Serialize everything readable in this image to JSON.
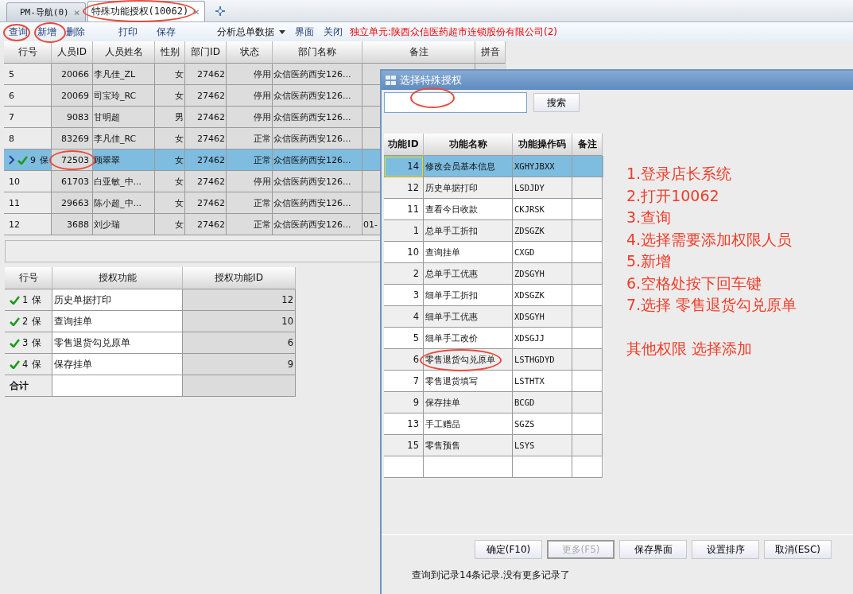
{
  "tabs": [
    {
      "label": "PM-导航(0)",
      "selected": false,
      "close": "×"
    },
    {
      "label": "特殊功能授权(10062)",
      "selected": true,
      "close": "×"
    }
  ],
  "toolbar": {
    "items": [
      {
        "label": "查询",
        "kind": "button"
      },
      {
        "label": "新增",
        "kind": "button"
      },
      {
        "label": "删除",
        "kind": "button"
      },
      {
        "label": "打印",
        "kind": "button"
      },
      {
        "label": "保存",
        "kind": "button"
      },
      {
        "label": "分析总单数据",
        "kind": "dropdown"
      },
      {
        "label": "界面",
        "kind": "button"
      },
      {
        "label": "关闭",
        "kind": "button"
      }
    ],
    "notice": "独立单元:陕西众信医药超市连锁股份有限公司(2)"
  },
  "main_grid": {
    "columns": [
      "行号",
      "人员ID",
      "人员姓名",
      "性别",
      "部门ID",
      "状态",
      "部门名称",
      "备注",
      "拼音"
    ],
    "rows": [
      {
        "no": "5",
        "id": "20066",
        "name": "李凡佳_ZL",
        "sex": "女",
        "dept_id": "27462",
        "status": "停用",
        "dept": "众信医药西安126...",
        "selected": false,
        "current": false,
        "saved": false
      },
      {
        "no": "6",
        "id": "20069",
        "name": "司宝玲_RC",
        "sex": "女",
        "dept_id": "27462",
        "status": "停用",
        "dept": "众信医药西安126...",
        "selected": false,
        "current": false,
        "saved": false
      },
      {
        "no": "7",
        "id": "9083",
        "name": "甘明超",
        "sex": "男",
        "dept_id": "27462",
        "status": "停用",
        "dept": "众信医药西安126...",
        "selected": false,
        "current": false,
        "saved": false
      },
      {
        "no": "8",
        "id": "83269",
        "name": "李凡佳_RC",
        "sex": "女",
        "dept_id": "27462",
        "status": "正常",
        "dept": "众信医药西安126...",
        "selected": false,
        "current": false,
        "saved": false
      },
      {
        "no": "9",
        "mark": "保",
        "id": "72503",
        "name": "顾翠翠",
        "sex": "女",
        "dept_id": "27462",
        "status": "正常",
        "dept": "众信医药西安126...",
        "selected": true,
        "current": true,
        "saved": true
      },
      {
        "no": "10",
        "id": "61703",
        "name": "白亚敏_中...",
        "sex": "女",
        "dept_id": "27462",
        "status": "停用",
        "dept": "众信医药西安126...",
        "selected": false,
        "current": false,
        "saved": false
      },
      {
        "no": "11",
        "id": "29663",
        "name": "陈小超_中...",
        "sex": "女",
        "dept_id": "27462",
        "status": "正常",
        "dept": "众信医药西安126...",
        "selected": false,
        "current": false,
        "saved": false
      },
      {
        "no": "12",
        "id": "3688",
        "name": "刘少瑞",
        "sex": "女",
        "dept_id": "27462",
        "status": "正常",
        "dept": "众信医药西安126...",
        "note": "01-",
        "selected": false,
        "current": false,
        "saved": false
      }
    ]
  },
  "auth_grid": {
    "columns": [
      "行号",
      "授权功能",
      "授权功能ID"
    ],
    "rows": [
      {
        "no": "1",
        "mark": "保",
        "function": "历史单据打印",
        "id": "12",
        "saved": true
      },
      {
        "no": "2",
        "mark": "保",
        "function": "查询挂单",
        "id": "10",
        "saved": true
      },
      {
        "no": "3",
        "mark": "保",
        "function": "零售退货勾兑原单",
        "id": "6",
        "saved": true
      },
      {
        "no": "4",
        "mark": "保",
        "function": "保存挂单",
        "id": "9",
        "saved": true
      }
    ],
    "total_label": "合计"
  },
  "dialog": {
    "title": "选择特殊授权",
    "search_button": "搜索",
    "columns": [
      "功能ID",
      "功能名称",
      "功能操作码",
      "备注"
    ],
    "rows": [
      {
        "id": "14",
        "name": "修改会员基本信息",
        "code": "XGHYJBXX",
        "selected": true
      },
      {
        "id": "12",
        "name": "历史单据打印",
        "code": "LSDJDY",
        "selected": false
      },
      {
        "id": "11",
        "name": "查看今日收款",
        "code": "CKJRSK",
        "selected": false
      },
      {
        "id": "1",
        "name": "总单手工折扣",
        "code": "ZDSGZK",
        "selected": false
      },
      {
        "id": "10",
        "name": "查询挂单",
        "code": "CXGD",
        "selected": false
      },
      {
        "id": "2",
        "name": "总单手工优惠",
        "code": "ZDSGYH",
        "selected": false
      },
      {
        "id": "3",
        "name": "细单手工折扣",
        "code": "XDSGZK",
        "selected": false
      },
      {
        "id": "4",
        "name": "细单手工优惠",
        "code": "XDSGYH",
        "selected": false
      },
      {
        "id": "5",
        "name": "细单手工改价",
        "code": "XDSGJJ",
        "selected": false
      },
      {
        "id": "6",
        "name": "零售退货勾兑原单",
        "code": "LSTHGDYD",
        "selected": false
      },
      {
        "id": "7",
        "name": "零售退货填写",
        "code": "LSTHTX",
        "selected": false
      },
      {
        "id": "9",
        "name": "保存挂单",
        "code": "BCGD",
        "selected": false
      },
      {
        "id": "13",
        "name": "手工赠品",
        "code": "SGZS",
        "selected": false
      },
      {
        "id": "15",
        "name": "零售预售",
        "code": "LSYS",
        "selected": false
      }
    ],
    "buttons": [
      {
        "label": "确定(F10)",
        "disabled": false
      },
      {
        "label": "更多(F5)",
        "disabled": true
      },
      {
        "label": "保存界面",
        "disabled": false
      },
      {
        "label": "设置排序",
        "disabled": false
      },
      {
        "label": "取消(ESC)",
        "disabled": false
      }
    ],
    "status": "查询到记录14条记录.没有更多记录了"
  },
  "instructions": [
    {
      "text": "1.登录店长系统",
      "kind": "step"
    },
    {
      "text": "2.打开10062",
      "kind": "step"
    },
    {
      "text": "3.查询",
      "kind": "step"
    },
    {
      "text": "4.选择需要添加权限人员",
      "kind": "step"
    },
    {
      "text": "5.新增",
      "kind": "step"
    },
    {
      "text": "6.空格处按下回车键",
      "kind": "step"
    },
    {
      "text": "7.选择 零售退货勾兑原单",
      "kind": "step"
    },
    {
      "text": "其他权限 选择添加",
      "kind": "note"
    }
  ]
}
